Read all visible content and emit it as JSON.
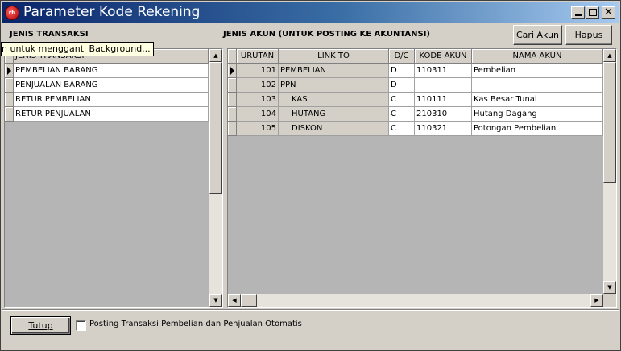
{
  "window": {
    "title": "Parameter Kode Rekening",
    "icon_text": "rh◉m"
  },
  "left_panel": {
    "heading": "JENIS TRANSAKSI",
    "column_header": "JENIS TRANSAKSI",
    "rows": [
      "PEMBELIAN BARANG",
      "PENJUALAN BARANG",
      "RETUR PEMBELIAN",
      "RETUR PENJUALAN"
    ],
    "active_row": 0
  },
  "tooltip": {
    "text": "n untuk mengganti Background..."
  },
  "right_panel": {
    "heading": "JENIS AKUN (UNTUK POSTING KE AKUNTANSI)",
    "buttons": {
      "find": "Cari Akun",
      "delete": "Hapus"
    },
    "columns": [
      "URUTAN",
      "LINK TO",
      "D/C",
      "KODE AKUN",
      "NAMA AKUN"
    ],
    "rows": [
      {
        "urutan": "101",
        "link_to": "PEMBELIAN",
        "dc": "D",
        "kode": "110311",
        "nama": "Pembelian"
      },
      {
        "urutan": "102",
        "link_to": "PPN",
        "dc": "D",
        "kode": "",
        "nama": ""
      },
      {
        "urutan": "103",
        "link_to": "KAS",
        "dc": "C",
        "kode": "110111",
        "nama": "Kas Besar Tunai"
      },
      {
        "urutan": "104",
        "link_to": "HUTANG",
        "dc": "C",
        "kode": "210310",
        "nama": "Hutang Dagang"
      },
      {
        "urutan": "105",
        "link_to": "DISKON",
        "dc": "C",
        "kode": "110321",
        "nama": "Potongan Pembelian"
      }
    ],
    "active_row": 0
  },
  "footer": {
    "close_button": "Tutup",
    "checkbox_label": "Posting Transaksi Pembelian dan Penjualan Otomatis",
    "checkbox_checked": false
  }
}
